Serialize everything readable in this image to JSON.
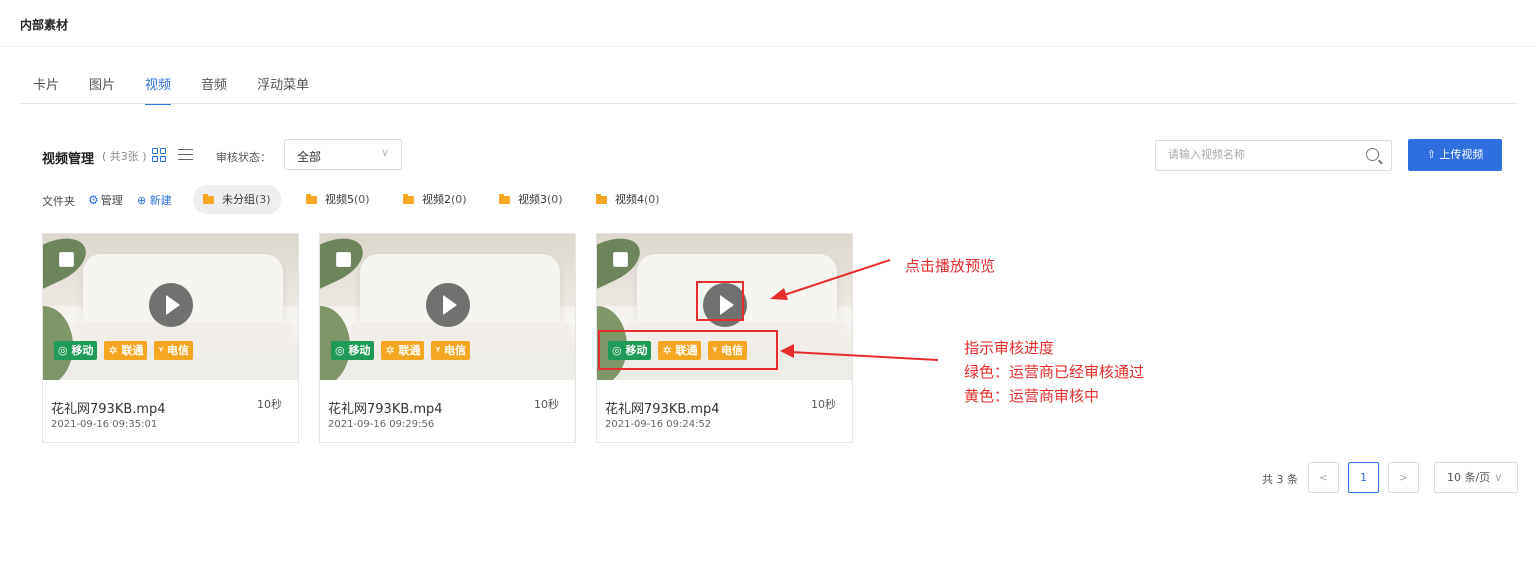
{
  "page": {
    "title": "内部素材"
  },
  "tabs": [
    {
      "label": "卡片",
      "active": false
    },
    {
      "label": "图片",
      "active": false
    },
    {
      "label": "视频",
      "active": true
    },
    {
      "label": "音频",
      "active": false
    },
    {
      "label": "浮动菜单",
      "active": false
    }
  ],
  "toolbar": {
    "title": "视频管理",
    "count_text": "( 共3张 )",
    "audit_label": "审核状态：",
    "audit_value": "全部",
    "search_placeholder": "请输入视频名称",
    "upload_label": "上传视频"
  },
  "folders": {
    "label": "文件夹",
    "manage_label": "管理",
    "new_label": "新建",
    "items": [
      {
        "name": "未分组",
        "count": "(3)",
        "selected": true
      },
      {
        "name": "视频5",
        "count": "(0)",
        "selected": false
      },
      {
        "name": "视频2",
        "count": "(0)",
        "selected": false
      },
      {
        "name": "视频3",
        "count": "(0)",
        "selected": false
      },
      {
        "name": "视频4",
        "count": "(0)",
        "selected": false
      }
    ]
  },
  "tags": {
    "mobile": "移动",
    "unicom": "联通",
    "telecom": "电信"
  },
  "videos": [
    {
      "name": "花礼网793KB.mp4",
      "duration": "10秒",
      "date": "2021-09-16 09:35:01"
    },
    {
      "name": "花礼网793KB.mp4",
      "duration": "10秒",
      "date": "2021-09-16 09:29:56"
    },
    {
      "name": "花礼网793KB.mp4",
      "duration": "10秒",
      "date": "2021-09-16 09:24:52"
    }
  ],
  "annotations": {
    "play_note": "点击播放预览",
    "progress_note_title": "指示审核进度",
    "progress_note_green": "绿色：运营商已经审核通过",
    "progress_note_yellow": "黄色：运营商审核中"
  },
  "pagination": {
    "total_text": "共 3 条",
    "prev": "<",
    "current": "1",
    "next": ">",
    "page_size": "10 条/页"
  },
  "colors": {
    "primary": "#2f6fe0",
    "approved": "#1f9a57",
    "pending": "#f5a623",
    "annotation": "#e62e2e"
  }
}
